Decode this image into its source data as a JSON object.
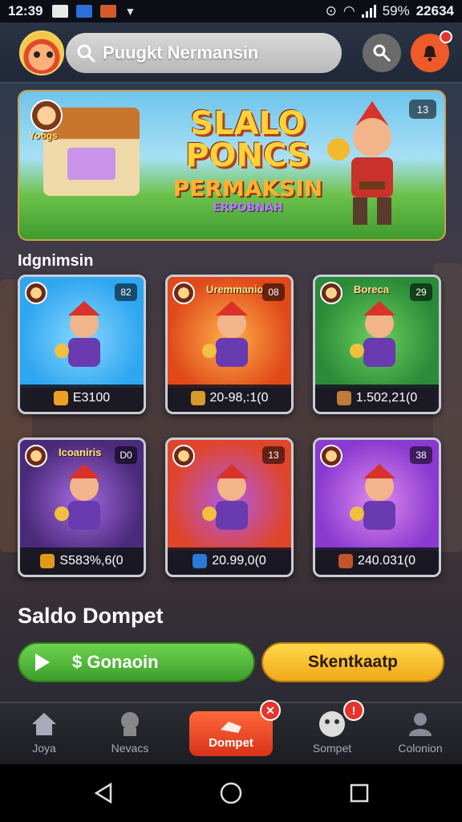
{
  "status_bar": {
    "time": "12:39",
    "battery": "59%",
    "extra": "22634"
  },
  "header": {
    "search_placeholder": "Puugkt Nermansin",
    "icons": [
      "avatar",
      "key-icon",
      "bell-icon"
    ]
  },
  "banner": {
    "logo_text": "Yoogs",
    "title_line1": "SLALO",
    "title_line2": "PONCS",
    "title_line3": "PERMAKSIN",
    "title_line4": "ERPOBNAH",
    "badge": "13"
  },
  "section": {
    "label": "Idgnimsin"
  },
  "games": [
    {
      "name": "",
      "count": "82",
      "value": "E3100",
      "color_a": "#2fa6f0",
      "color_b": "#88d8ff",
      "coin": "#f0a020"
    },
    {
      "name": "Uremmanio",
      "count": "08",
      "value": "20-98,:1(0",
      "color_a": "#e04a1a",
      "color_b": "#ffb04a",
      "coin": "#d89a2a"
    },
    {
      "name": "Boreca",
      "count": "29",
      "value": "1.502,21(0",
      "color_a": "#2a8a3a",
      "color_b": "#6ad05a",
      "coin": "#c07a3a"
    },
    {
      "name": "Icoaniris",
      "count": "D0",
      "value": "S583%,6(0",
      "color_a": "#4a2a7a",
      "color_b": "#a56ae0",
      "coin": "#e09a1a"
    },
    {
      "name": "",
      "count": "13",
      "value": "20.99,0(0",
      "color_a": "#e0452a",
      "color_b": "#b05ae8",
      "coin": "#2a7ad8"
    },
    {
      "name": "",
      "count": "38",
      "value": "240.031(0",
      "color_a": "#8a3ad0",
      "color_b": "#e08af0",
      "coin": "#c0552a"
    }
  ],
  "wallet": {
    "title": "Saldo Dompet",
    "primary_button": "$ Gonaoin",
    "secondary_button": "Skentkaatp"
  },
  "bottom_nav": {
    "items": [
      {
        "label": "Joya",
        "icon": "home-icon"
      },
      {
        "label": "Nevacs",
        "icon": "character-icon"
      },
      {
        "label": "Dompet",
        "icon": "wallet-icon"
      },
      {
        "label": "Sompet",
        "icon": "face-icon"
      },
      {
        "label": "Colonion",
        "icon": "user-icon"
      }
    ]
  }
}
